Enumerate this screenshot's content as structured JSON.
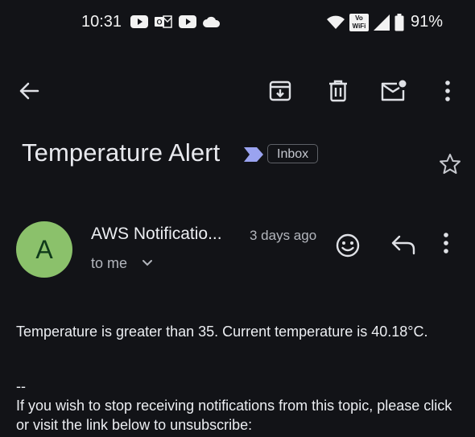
{
  "status_bar": {
    "time": "10:31",
    "battery": "91%",
    "vowifi_top": "Vo",
    "vowifi_bottom": "WiFi",
    "left_icons": [
      "youtube-icon",
      "outlook-icon",
      "youtube-icon",
      "cloud-icon"
    ],
    "right_icons": [
      "wifi-icon",
      "vowifi-icon",
      "signal-icon",
      "battery-icon"
    ]
  },
  "toolbar": {
    "icons": [
      "back-arrow-icon",
      "archive-icon",
      "delete-icon",
      "mark-unread-icon",
      "more-vert-icon"
    ]
  },
  "email": {
    "subject": "Temperature Alert",
    "label": "Inbox",
    "sender_initial": "A",
    "sender": "AWS Notificatio...",
    "date": "3 days ago",
    "recipient": "to me",
    "body": "Temperature is greater than 35. Current temperature is 40.18°C.",
    "separator": "--",
    "unsubscribe_text": "If you wish to stop receiving notifications from this topic, please click or visit the link below to unsubscribe:"
  },
  "colors": {
    "background": "#121317",
    "avatar": "#8bc16b",
    "importance_marker": "#9aa3f0"
  }
}
